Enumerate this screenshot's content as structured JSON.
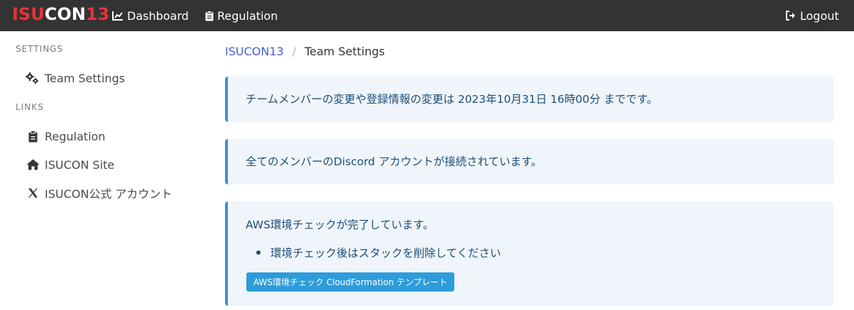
{
  "navbar": {
    "logo": {
      "part1": "ISU",
      "part2": "CON",
      "part3": "13"
    },
    "dashboard_label": "Dashboard",
    "regulation_label": "Regulation",
    "logout_label": "Logout"
  },
  "sidebar": {
    "settings_heading": "SETTINGS",
    "settings_items": [
      {
        "label": "Team Settings",
        "icon": "gears-icon"
      }
    ],
    "links_heading": "LINKS",
    "links_items": [
      {
        "label": "Regulation",
        "icon": "clipboard-icon"
      },
      {
        "label": "ISUCON Site",
        "icon": "home-icon"
      },
      {
        "label": "ISUCON公式 アカウント",
        "icon": "x-logo-icon"
      }
    ]
  },
  "breadcrumb": {
    "root": "ISUCON13",
    "separator": "/",
    "current": "Team Settings"
  },
  "notices": {
    "deadline": "チームメンバーの変更や登録情報の変更は 2023年10月31日 16時00分 までです。",
    "discord": "全てのメンバーのDiscord アカウントが接続されています。",
    "aws": {
      "text": "AWS環境チェックが完了しています。",
      "bullet": "環境チェック後はスタックを削除してください",
      "button_label": "AWS環境チェック CloudFormation テンプレート"
    }
  },
  "colors": {
    "navbar_bg": "#333333",
    "logo_accent": "#e8323a",
    "link": "#485fc7",
    "notice_bg": "#eff5fb",
    "notice_border": "#3e8ed0",
    "button_bg": "#2d9cdb"
  }
}
